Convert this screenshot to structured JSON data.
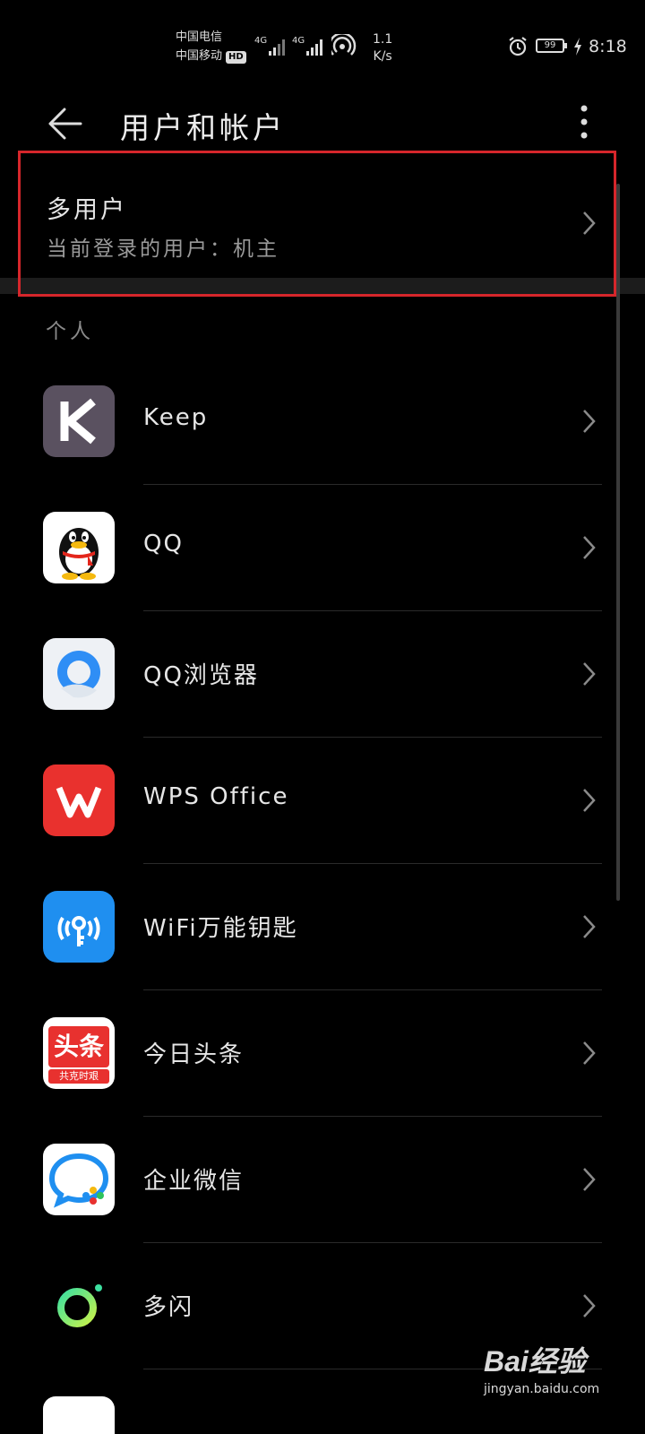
{
  "status_bar": {
    "carrier1": "中国电信",
    "carrier2": "中国移动",
    "hd_badge": "HD",
    "net_label_1": "4G",
    "net_label_2": "4G",
    "speed_value": "1.1",
    "speed_unit": "K/s",
    "battery": "99",
    "time": "8:18"
  },
  "app_bar": {
    "title": "用户和帐户"
  },
  "multi_user": {
    "title": "多用户",
    "subtitle": "当前登录的用户：机主"
  },
  "section": {
    "label": "个人"
  },
  "accounts": [
    {
      "label": "Keep",
      "icon": "keep-icon"
    },
    {
      "label": "QQ",
      "icon": "qq-icon"
    },
    {
      "label": "QQ浏览器",
      "icon": "qq-browser-icon"
    },
    {
      "label": "WPS Office",
      "icon": "wps-office-icon"
    },
    {
      "label": "WiFi万能钥匙",
      "icon": "wifi-key-icon"
    },
    {
      "label": "今日头条",
      "icon": "toutiao-icon"
    },
    {
      "label": "企业微信",
      "icon": "wecom-icon"
    },
    {
      "label": "多闪",
      "icon": "duoshan-icon"
    }
  ],
  "icon_text": {
    "toutiao_main": "头条",
    "toutiao_sub": "共克时艰"
  },
  "watermark": {
    "logo": "Bai经验",
    "url": "jingyan.baidu.com"
  },
  "colors": {
    "background": "#000000",
    "highlight_border": "#d6262b",
    "keep": "#5a5160",
    "wps": "#e9312e",
    "wifi": "#1f8ff0",
    "toutiao": "#e8312f"
  }
}
